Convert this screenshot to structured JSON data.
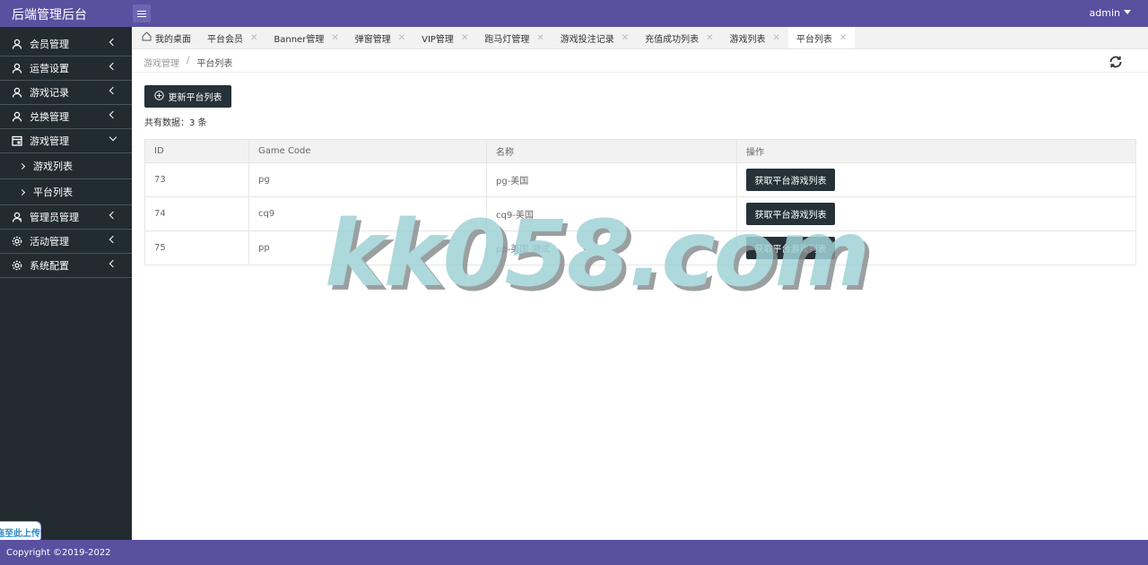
{
  "header": {
    "title": "后端管理后台",
    "user": "admin"
  },
  "sidebar": {
    "items": [
      {
        "label": "会员管理",
        "icon": "user-icon"
      },
      {
        "label": "运营设置",
        "icon": "user-icon"
      },
      {
        "label": "游戏记录",
        "icon": "user-icon"
      },
      {
        "label": "兑换管理",
        "icon": "user-icon"
      },
      {
        "label": "游戏管理",
        "icon": "calendar-icon",
        "expanded": true,
        "children": [
          {
            "label": "游戏列表"
          },
          {
            "label": "平台列表"
          }
        ]
      },
      {
        "label": "管理员管理",
        "icon": "admin-icon"
      },
      {
        "label": "活动管理",
        "icon": "gear-icon"
      },
      {
        "label": "系统配置",
        "icon": "gear-icon"
      }
    ],
    "upload_label": "拖至此上传"
  },
  "tabs": [
    {
      "label": "我的桌面",
      "closable": false
    },
    {
      "label": "平台会员",
      "closable": true
    },
    {
      "label": "Banner管理",
      "closable": true
    },
    {
      "label": "弹窗管理",
      "closable": true
    },
    {
      "label": "VIP管理",
      "closable": true
    },
    {
      "label": "跑马灯管理",
      "closable": true
    },
    {
      "label": "游戏投注记录",
      "closable": true
    },
    {
      "label": "充值成功列表",
      "closable": true
    },
    {
      "label": "游戏列表",
      "closable": true
    },
    {
      "label": "平台列表",
      "closable": true,
      "active": true
    }
  ],
  "breadcrumb": {
    "parent": "游戏管理",
    "sep": "/",
    "current": "平台列表"
  },
  "main": {
    "update_label": "更新平台列表",
    "count_text": "共有数据：3 条",
    "table": {
      "headers": [
        "ID",
        "Game Code",
        "名称",
        "操作"
      ],
      "rows": [
        {
          "id": "73",
          "code": "pg",
          "name": "pg-美国",
          "action": "获取平台游戏列表"
        },
        {
          "id": "74",
          "code": "cq9",
          "name": "cq9-美国",
          "action": "获取平台游戏列表"
        },
        {
          "id": "75",
          "code": "pp",
          "name": "pp-美国-测试",
          "action": "获取平台游戏列表"
        }
      ]
    }
  },
  "watermark": "kk058.com",
  "footer": {
    "copyright": "Copyright ©2019-2022"
  },
  "colors": {
    "header": "#5a50a0",
    "sidebar": "#212b30",
    "button": "#263238"
  }
}
